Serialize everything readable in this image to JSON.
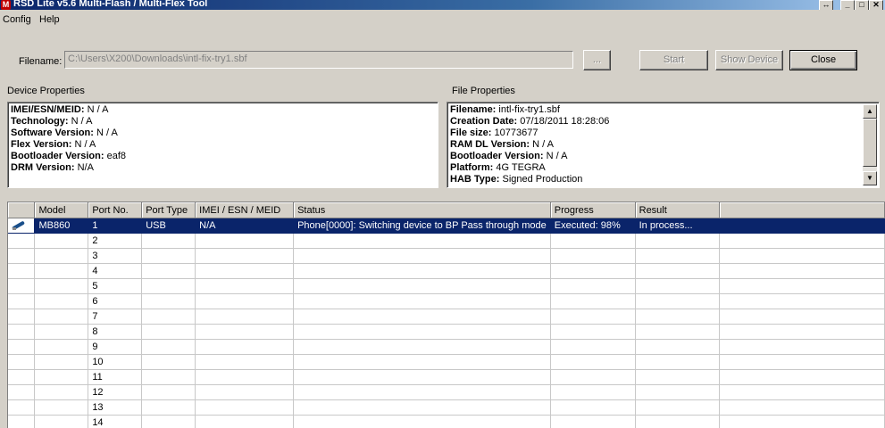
{
  "window": {
    "title": "RSD Lite v5.6 Multi-Flash / Multi-Flex Tool",
    "app_icon": "motorola-logo-icon",
    "controls": [
      "restore-icon",
      "minimize-icon",
      "maximize-icon",
      "close-icon"
    ]
  },
  "menu": {
    "items": [
      "Config",
      "Help"
    ]
  },
  "file": {
    "label": "Filename:",
    "value": "C:\\Users\\X200\\Downloads\\intl-fix-try1.sbf",
    "browse_label": "...",
    "start_label": "Start",
    "show_device_label": "Show Device",
    "close_label": "Close"
  },
  "device_properties": {
    "title": "Device Properties",
    "rows": [
      {
        "key": "IMEI/ESN/MEID:",
        "value": " N / A"
      },
      {
        "key": "Technology:",
        "value": " N / A"
      },
      {
        "key": "Software Version:",
        "value": " N / A"
      },
      {
        "key": "Flex Version:",
        "value": " N / A"
      },
      {
        "key": "Bootloader Version:",
        "value": " eaf8"
      },
      {
        "key": "DRM Version:",
        "value": " N/A"
      }
    ]
  },
  "file_properties": {
    "title": "File Properties",
    "rows": [
      {
        "key": "Filename:",
        "value": " intl-fix-try1.sbf"
      },
      {
        "key": "Creation Date:",
        "value": " 07/18/2011 18:28:06"
      },
      {
        "key": "File size:",
        "value": " 10773677"
      },
      {
        "key": "RAM DL Version:",
        "value": " N / A"
      },
      {
        "key": "Bootloader Version:",
        "value": " N / A"
      },
      {
        "key": "Platform:",
        "value": " 4G TEGRA"
      },
      {
        "key": "HAB Type:",
        "value": " Signed Production"
      }
    ]
  },
  "device_table": {
    "columns": [
      "",
      "Model",
      "Port No.",
      "Port Type",
      "IMEI / ESN / MEID",
      "Status",
      "Progress",
      "Result",
      ""
    ],
    "rows": [
      {
        "icon": "usb-probe-icon",
        "model": "MB860",
        "port": "1",
        "type": "USB",
        "imei": "N/A",
        "status": "Phone[0000]: Switching device to BP Pass through mode",
        "progress": "Executed: 98%",
        "result": "In process...",
        "selected": true
      },
      {
        "port": "2"
      },
      {
        "port": "3"
      },
      {
        "port": "4"
      },
      {
        "port": "5"
      },
      {
        "port": "6"
      },
      {
        "port": "7"
      },
      {
        "port": "8"
      },
      {
        "port": "9"
      },
      {
        "port": "10"
      },
      {
        "port": "11"
      },
      {
        "port": "12"
      },
      {
        "port": "13"
      },
      {
        "port": "14"
      }
    ]
  },
  "colors": {
    "selection": "#0a246a",
    "titlebar": "#0a246a",
    "face": "#d4d0c8"
  }
}
